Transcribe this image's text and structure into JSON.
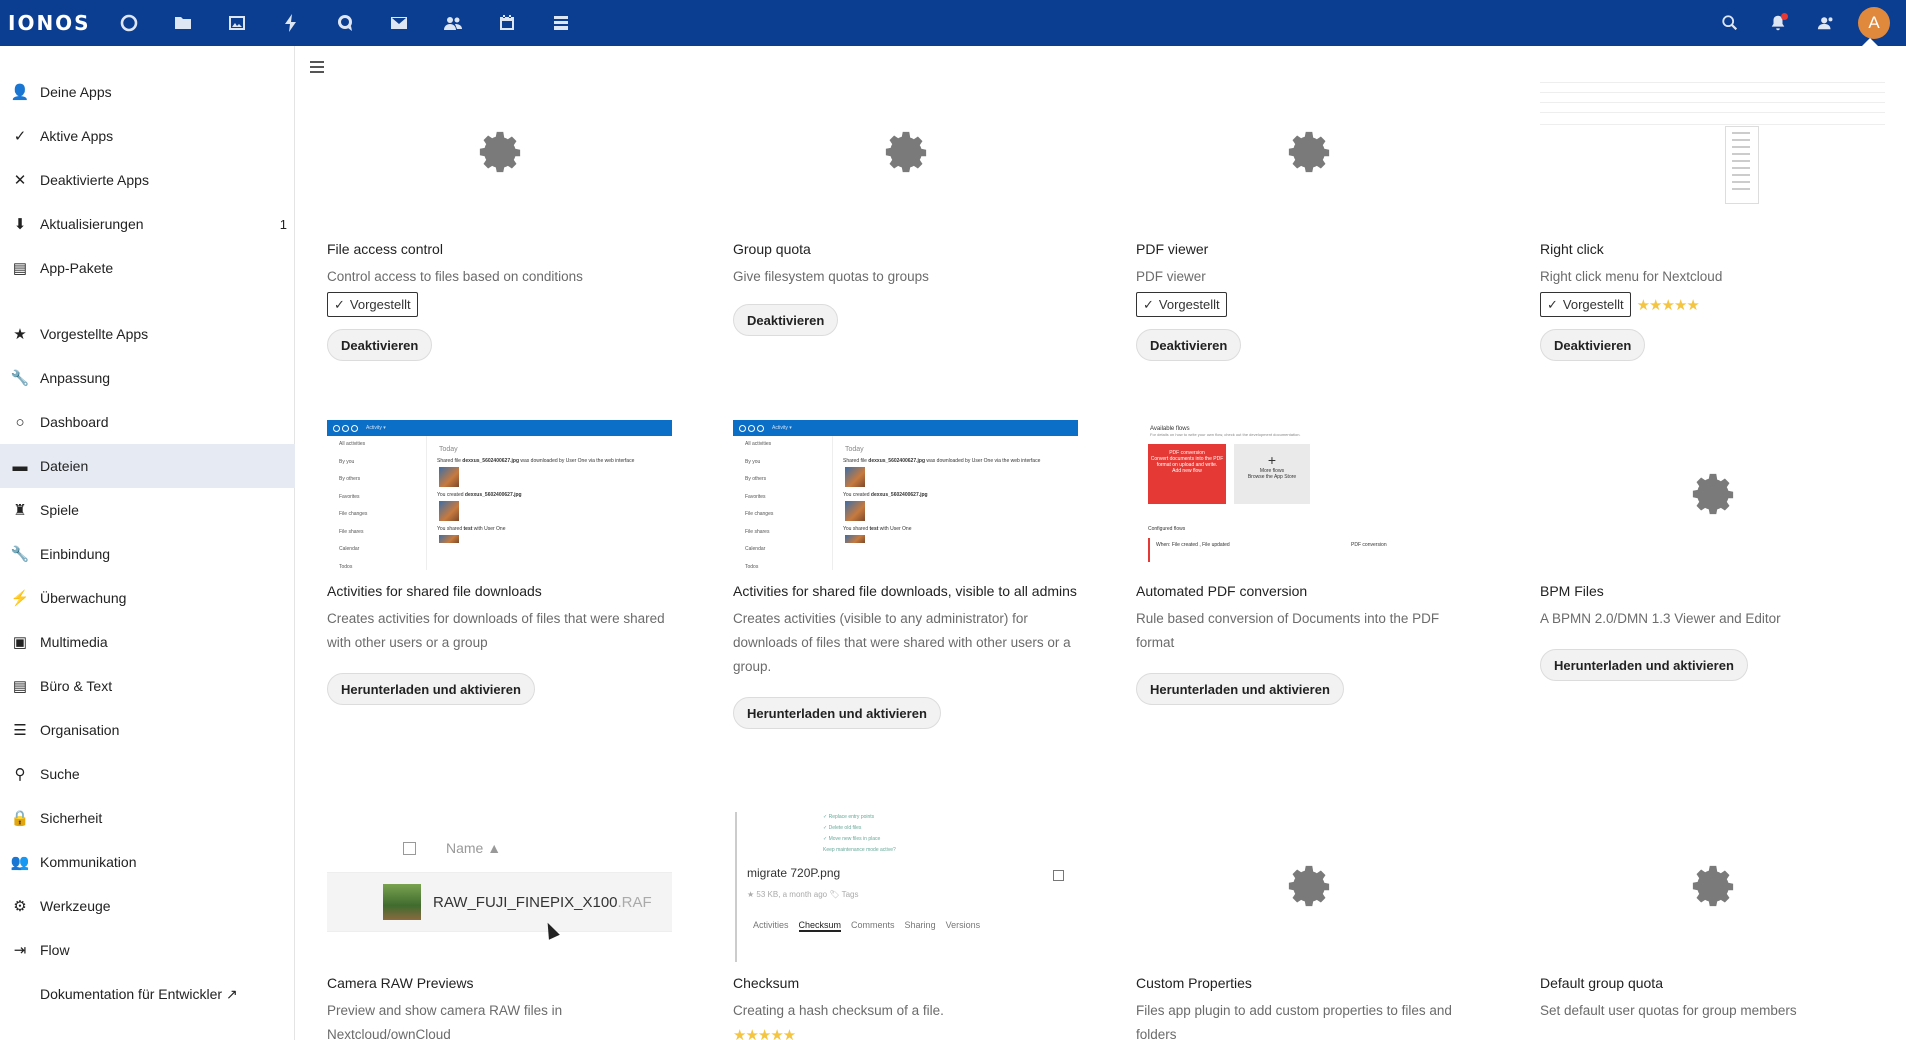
{
  "header": {
    "logo": "IONOS",
    "apps": [
      "dashboard-icon",
      "files-icon",
      "photos-icon",
      "activity-icon",
      "talk-icon",
      "mail-icon",
      "contacts-icon",
      "calendar-icon",
      "deck-icon"
    ],
    "right": [
      "search-icon",
      "notifications-icon",
      "contacts-menu-icon"
    ],
    "avatar_letter": "A"
  },
  "sidebar": {
    "items": [
      {
        "label": "Deine Apps",
        "icon": "user-icon",
        "glyph": "👤"
      },
      {
        "label": "Aktive Apps",
        "icon": "check-icon",
        "glyph": "✓"
      },
      {
        "label": "Deaktivierte Apps",
        "icon": "close-icon",
        "glyph": "✕"
      },
      {
        "label": "Aktualisierungen",
        "icon": "download-icon",
        "glyph": "⬇",
        "count": "1"
      },
      {
        "label": "App-Pakete",
        "icon": "package-icon",
        "glyph": "▤"
      },
      {
        "label": "Vorgestellte Apps",
        "icon": "star-icon",
        "glyph": "★"
      },
      {
        "label": "Anpassung",
        "icon": "wrench-icon",
        "glyph": "🔧"
      },
      {
        "label": "Dashboard",
        "icon": "circle-icon",
        "glyph": "○"
      },
      {
        "label": "Dateien",
        "icon": "folder-icon",
        "glyph": "▬"
      },
      {
        "label": "Spiele",
        "icon": "games-icon",
        "glyph": "♜"
      },
      {
        "label": "Einbindung",
        "icon": "wrench-icon",
        "glyph": "🔧"
      },
      {
        "label": "Überwachung",
        "icon": "activity-icon",
        "glyph": "⚡"
      },
      {
        "label": "Multimedia",
        "icon": "image-icon",
        "glyph": "▣"
      },
      {
        "label": "Büro & Text",
        "icon": "document-icon",
        "glyph": "▤"
      },
      {
        "label": "Organisation",
        "icon": "list-icon",
        "glyph": "☰"
      },
      {
        "label": "Suche",
        "icon": "search-icon",
        "glyph": "⚲"
      },
      {
        "label": "Sicherheit",
        "icon": "lock-icon",
        "glyph": "🔒"
      },
      {
        "label": "Kommunikation",
        "icon": "contacts-icon",
        "glyph": "👥"
      },
      {
        "label": "Werkzeuge",
        "icon": "gear-icon",
        "glyph": "⚙"
      },
      {
        "label": "Flow",
        "icon": "flow-icon",
        "glyph": "⇥"
      },
      {
        "label": "Dokumentation für Entwickler ↗",
        "icon": "",
        "glyph": ""
      }
    ]
  },
  "apps": [
    {
      "name": "File access control",
      "desc": "Control access to files based on conditions",
      "featured": "Vorgestellt",
      "button": "Deaktivieren"
    },
    {
      "name": "Group quota",
      "desc": "Give filesystem quotas to groups",
      "button": "Deaktivieren"
    },
    {
      "name": "PDF viewer",
      "desc": "PDF viewer",
      "featured": "Vorgestellt",
      "button": "Deaktivieren"
    },
    {
      "name": "Right click",
      "desc": "Right click menu for Nextcloud",
      "featured": "Vorgestellt",
      "stars": "★★★★★",
      "rating": 4.5,
      "button": "Deaktivieren"
    },
    {
      "name": "Activities for shared file downloads",
      "desc": "Creates activities for downloads of files that were shared with other users or a group",
      "button": "Herunterladen und aktivieren"
    },
    {
      "name": "Activities for shared file downloads, visible to all admins",
      "desc": "Creates activities (visible to any administrator) for downloads of files that were shared with other users or a group.",
      "button": "Herunterladen und aktivieren"
    },
    {
      "name": "Automated PDF conversion",
      "desc": "Rule based conversion of Documents into the PDF format",
      "button": "Herunterladen und aktivieren"
    },
    {
      "name": "BPM Files",
      "desc": "A BPMN 2.0/DMN 1.3 Viewer and Editor",
      "button": "Herunterladen und aktivieren"
    },
    {
      "name": "Camera RAW Previews",
      "desc": "Preview and show camera RAW files in Nextcloud/ownCloud"
    },
    {
      "name": "Checksum",
      "desc": "Creating a hash checksum of a file.",
      "stars": "★★★★★",
      "rating": 4.5
    },
    {
      "name": "Custom Properties",
      "desc": "Files app plugin to add custom properties to files and folders"
    },
    {
      "name": "Default group quota",
      "desc": "Set default user quotas for group members"
    }
  ],
  "previews": {
    "activity": {
      "menu": "Activity ▾",
      "side": [
        "All activities",
        "By you",
        "By others",
        "Favorites",
        "File changes",
        "File shares",
        "Calendar",
        "Todos"
      ],
      "today": "Today",
      "line1_a": "Shared file ",
      "line1_b": "dexxus_5602400627.jpg",
      "line1_c": " was downloaded by User One via the web interface",
      "line2_a": "You created ",
      "line2_b": "dexxus_5602400627.jpg",
      "line3_a": "You shared ",
      "line3_b": "test",
      "line3_c": " with User One"
    },
    "pdf": {
      "title": "Available flows",
      "sub": "For details on how to write your own flow, check out the development documentation.",
      "red_title": "PDF conversion",
      "red_desc": "Convert documents into the PDF format on upload and write.",
      "red_btn": "Add new flow",
      "more": "More flows",
      "more_desc": "Browse the App Store",
      "configured": "Configured flows",
      "when": "When:",
      "rule": "File created , File updated",
      "action": "PDF conversion"
    },
    "raw": {
      "column": "Name ▲",
      "file": "RAW_FUJI_FINEPIX_X100",
      "ext": ".RAF"
    },
    "checksum": {
      "top": [
        "✓ Replace entry points",
        "✓ Delete old files",
        "✓ Move new files in place",
        "Keep maintenance mode active?"
      ],
      "file": "migrate 720P.png",
      "meta": "★ 53 KB, a month ago   🏷 Tags",
      "tabs": [
        "Activities",
        "Checksum",
        "Comments",
        "Sharing",
        "Versions"
      ]
    }
  },
  "colors": {
    "header": "#0b3d91",
    "accent": "#0b6fc7",
    "star": "#f4c542",
    "avatar": "#e0883c"
  }
}
